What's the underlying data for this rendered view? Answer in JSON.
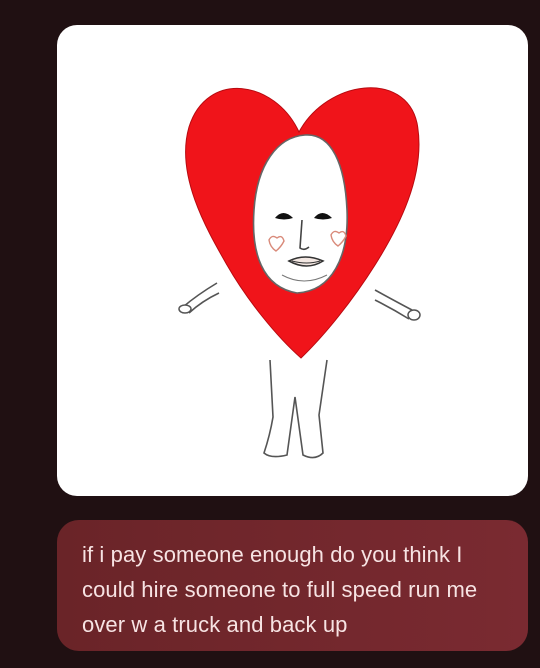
{
  "conversation": {
    "image_message": {
      "description_icon": "heart-costume-drawing"
    },
    "text_message": {
      "text": "if i pay someone enough do you think I could hire someone to full speed run me over w a truck and back up"
    }
  },
  "colors": {
    "background": "#201012",
    "bubble": "#722830",
    "bubble_text": "#f7e3e3",
    "heart_red": "#f0141a"
  }
}
